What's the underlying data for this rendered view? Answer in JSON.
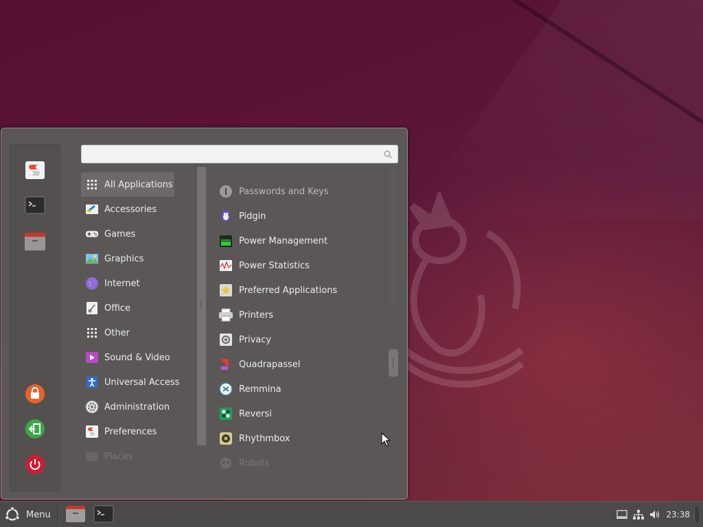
{
  "search": {
    "value": "",
    "placeholder": ""
  },
  "favorites": [
    {
      "icon": "settings-toggle-icon"
    },
    {
      "icon": "terminal-icon"
    },
    {
      "icon": "file-manager-icon"
    }
  ],
  "session": [
    {
      "icon": "lock-icon"
    },
    {
      "icon": "logout-icon"
    },
    {
      "icon": "power-icon"
    }
  ],
  "categories": [
    {
      "label": "All Applications",
      "icon": "grid-icon"
    },
    {
      "label": "Accessories",
      "icon": "accessories-icon"
    },
    {
      "label": "Games",
      "icon": "gamepad-icon"
    },
    {
      "label": "Graphics",
      "icon": "image-icon"
    },
    {
      "label": "Internet",
      "icon": "globe-icon"
    },
    {
      "label": "Office",
      "icon": "office-icon"
    },
    {
      "label": "Other",
      "icon": "grid-icon"
    },
    {
      "label": "Sound & Video",
      "icon": "play-icon"
    },
    {
      "label": "Universal Access",
      "icon": "accessibility-icon"
    },
    {
      "label": "Administration",
      "icon": "gear-icon"
    },
    {
      "label": "Preferences",
      "icon": "preferences-icon"
    },
    {
      "label": "Places",
      "icon": "folder-icon"
    }
  ],
  "apps": [
    {
      "label": "Passwords and Keys",
      "icon": "keyring-icon"
    },
    {
      "label": "Pidgin",
      "icon": "pidgin-icon"
    },
    {
      "label": "Power Management",
      "icon": "battery-icon"
    },
    {
      "label": "Power Statistics",
      "icon": "graph-icon"
    },
    {
      "label": "Preferred Applications",
      "icon": "star-icon"
    },
    {
      "label": "Printers",
      "icon": "printer-icon"
    },
    {
      "label": "Privacy",
      "icon": "privacy-icon"
    },
    {
      "label": "Quadrapassel",
      "icon": "blocks-icon"
    },
    {
      "label": "Remmina",
      "icon": "remmina-icon"
    },
    {
      "label": "Reversi",
      "icon": "reversi-icon"
    },
    {
      "label": "Rhythmbox",
      "icon": "speaker-icon"
    },
    {
      "label": "Robots",
      "icon": "robot-icon"
    }
  ],
  "taskbar": {
    "menu_label": "Menu",
    "windows": [
      {
        "icon": "file-manager-icon"
      },
      {
        "icon": "terminal-icon"
      }
    ],
    "tray": [
      {
        "icon": "display-icon"
      },
      {
        "icon": "network-icon"
      },
      {
        "icon": "volume-icon"
      }
    ],
    "clock": "23:38"
  },
  "colors": {
    "menu_bg": "#5b5757",
    "active_category": "#6d6969",
    "taskbar_bg": "#4b4949",
    "wallpaper": "#5e1a3a"
  }
}
